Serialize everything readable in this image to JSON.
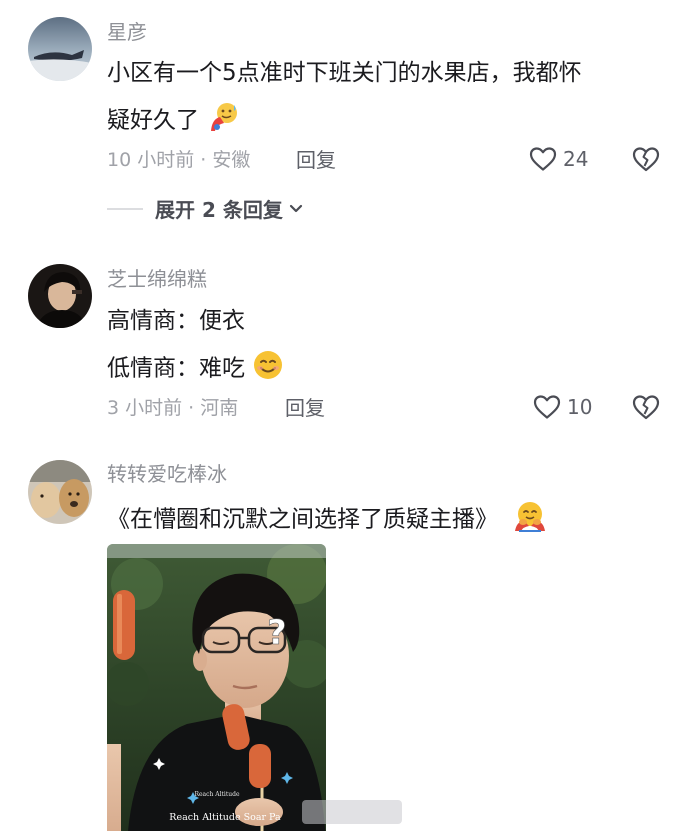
{
  "comments": [
    {
      "username": "星彦",
      "lines": [
        "小区有一个5点准时下班关门的水果店，我都怀",
        "疑好久了"
      ],
      "meta": "10 小时前 · 安徽",
      "reply": "回复",
      "likes": "24",
      "expand": "展开 2 条回复",
      "emoji": "face-with-cold-sweat-and-tongue"
    },
    {
      "username": "芝士绵绵糕",
      "lines": [
        "高情商：便衣",
        "低情商：难吃"
      ],
      "meta": "3 小时前 · 河南",
      "reply": "回复",
      "likes": "10",
      "emoji": "smiling-face"
    },
    {
      "username": "转转爱吃棒冰",
      "lines": [
        "《在懵圈和沉默之间选择了质疑主播》"
      ],
      "emoji": "hugging-face",
      "photo_shirt_text": [
        "Reach Altitude",
        "Reach Altitude Soar Pa"
      ]
    }
  ],
  "icons": {
    "like": "heart-outline-icon",
    "dislike": "broken-heart-icon",
    "expand": "chevron-down-icon"
  },
  "colors": {
    "text": "#1b1b1f",
    "muted": "#8e9096",
    "meta": "#a0a2a8"
  }
}
